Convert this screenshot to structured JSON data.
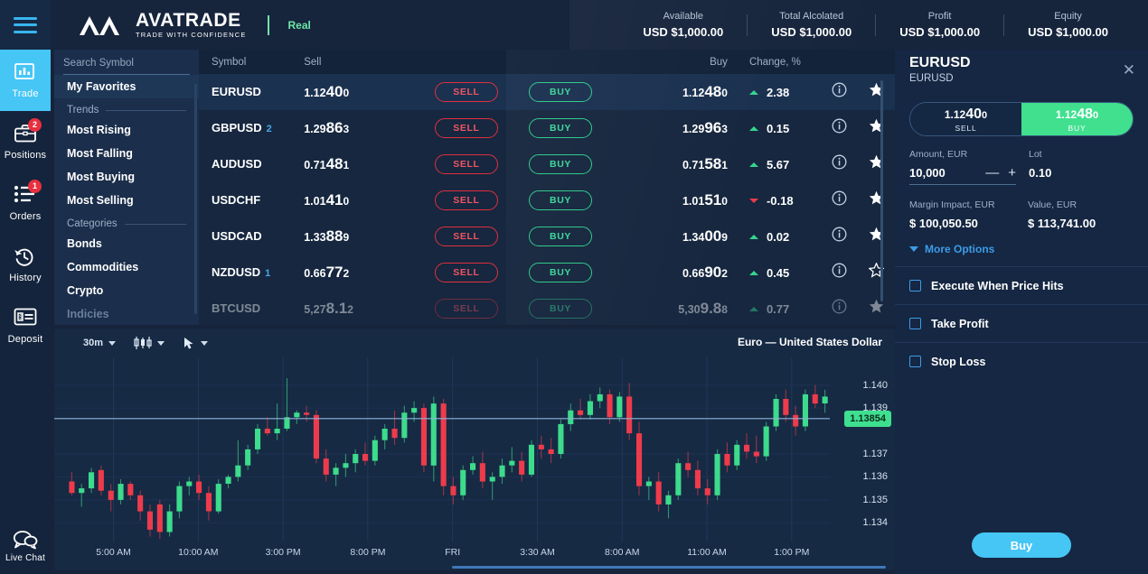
{
  "header": {
    "logo_main": "AVATRADE",
    "logo_sub": "TRADE WITH CONFIDENCE",
    "account_type": "Real",
    "accounts": [
      {
        "label": "Available",
        "value": "USD $1,000.00"
      },
      {
        "label": "Total Alcolated",
        "value": "USD $1,000.00"
      },
      {
        "label": "Profit",
        "value": "USD $1,000.00"
      },
      {
        "label": "Equity",
        "value": "USD $1,000.00"
      }
    ]
  },
  "rail": {
    "items": [
      {
        "label": "Trade",
        "icon": "bar-chart-icon",
        "badge": "",
        "active": true
      },
      {
        "label": "Positions",
        "icon": "briefcase-icon",
        "badge": "2",
        "active": false
      },
      {
        "label": "Orders",
        "icon": "list-icon",
        "badge": "1",
        "active": false
      },
      {
        "label": "History",
        "icon": "clock-history-icon",
        "badge": "",
        "active": false
      },
      {
        "label": "Deposit",
        "icon": "card-icon",
        "badge": "",
        "active": false
      }
    ],
    "live_chat": "Live Chat"
  },
  "symbol_nav": {
    "search_placeholder": "Search Symbol",
    "search_value": "",
    "favorites": "My Favorites",
    "trends_label": "Trends",
    "trends": [
      "Most Rising",
      "Most Falling",
      "Most Buying",
      "Most Selling"
    ],
    "categories_label": "Categories",
    "categories": [
      "Bonds",
      "Commodities",
      "Crypto",
      "Indicies"
    ]
  },
  "quotes": {
    "columns": {
      "symbol": "Symbol",
      "sell": "Sell",
      "buy": "Buy",
      "change": "Change, %"
    },
    "sell_button": "SELL",
    "buy_button": "BUY",
    "rows": [
      {
        "symbol": "EURUSD",
        "count": "",
        "sell": [
          "1.12",
          "40",
          "0"
        ],
        "buy": [
          "1.12",
          "48",
          "0"
        ],
        "change": "2.38",
        "dir": "up",
        "star": "filled",
        "selected": true,
        "faded": false
      },
      {
        "symbol": "GBPUSD",
        "count": "2",
        "sell": [
          "1.29",
          "86",
          "3"
        ],
        "buy": [
          "1.29",
          "96",
          "3"
        ],
        "change": "0.15",
        "dir": "up",
        "star": "filled",
        "selected": false,
        "faded": false
      },
      {
        "symbol": "AUDUSD",
        "count": "",
        "sell": [
          "0.71",
          "48",
          "1"
        ],
        "buy": [
          "0.71",
          "58",
          "1"
        ],
        "change": "5.67",
        "dir": "up",
        "star": "filled",
        "selected": false,
        "faded": false
      },
      {
        "symbol": "USDCHF",
        "count": "",
        "sell": [
          "1.01",
          "41",
          "0"
        ],
        "buy": [
          "1.01",
          "51",
          "0"
        ],
        "change": "-0.18",
        "dir": "down",
        "star": "filled",
        "selected": false,
        "faded": false
      },
      {
        "symbol": "USDCAD",
        "count": "",
        "sell": [
          "1.33",
          "88",
          "9"
        ],
        "buy": [
          "1.34",
          "00",
          "9"
        ],
        "change": "0.02",
        "dir": "up",
        "star": "filled",
        "selected": false,
        "faded": false
      },
      {
        "symbol": "NZDUSD",
        "count": "1",
        "sell": [
          "0.66",
          "77",
          "2"
        ],
        "buy": [
          "0.66",
          "90",
          "2"
        ],
        "change": "0.45",
        "dir": "up",
        "star": "empty",
        "selected": false,
        "faded": false
      },
      {
        "symbol": "BTCUSD",
        "count": "",
        "sell": [
          "5,27",
          "8.1",
          "2"
        ],
        "buy": [
          "5,30",
          "9.8",
          "8"
        ],
        "change": "0.77",
        "dir": "up",
        "star": "filled",
        "selected": false,
        "faded": true
      }
    ]
  },
  "chart": {
    "timeframe": "30m",
    "chart_type_icon": "candlestick-icon",
    "cursor_icon": "cursor-icon",
    "title": "Euro — United States Dollar",
    "current_price": "1.13854"
  },
  "chart_data": {
    "type": "candlestick",
    "title": "Euro — United States Dollar",
    "timeframe": "30m",
    "ylabel": "",
    "xlabel": "",
    "grid": true,
    "ylim": [
      1.1335,
      1.1405
    ],
    "y_ticks": [
      "1.140",
      "1.139",
      "1.137",
      "1.136",
      "1.135",
      "1.134"
    ],
    "x_ticks": [
      "5:00 AM",
      "10:00 AM",
      "3:00 PM",
      "8:00 PM",
      "FRI",
      "3:30 AM",
      "8:00 AM",
      "11:00 AM",
      "1:00 PM"
    ],
    "current_price": 1.13854,
    "price_line": 1.13854,
    "up_color": "#3ddb8c",
    "down_color": "#ee3b4b",
    "candles": [
      {
        "o": 1.1358,
        "h": 1.1362,
        "l": 1.1352,
        "c": 1.1353
      },
      {
        "o": 1.1353,
        "h": 1.1357,
        "l": 1.1347,
        "c": 1.1355
      },
      {
        "o": 1.1355,
        "h": 1.1364,
        "l": 1.1353,
        "c": 1.1362
      },
      {
        "o": 1.1363,
        "h": 1.1365,
        "l": 1.1352,
        "c": 1.1354
      },
      {
        "o": 1.1354,
        "h": 1.1357,
        "l": 1.1345,
        "c": 1.135
      },
      {
        "o": 1.135,
        "h": 1.1359,
        "l": 1.1348,
        "c": 1.1357
      },
      {
        "o": 1.1357,
        "h": 1.1358,
        "l": 1.135,
        "c": 1.1352
      },
      {
        "o": 1.1352,
        "h": 1.1354,
        "l": 1.1341,
        "c": 1.1345
      },
      {
        "o": 1.1345,
        "h": 1.1348,
        "l": 1.1334,
        "c": 1.1337
      },
      {
        "o": 1.1348,
        "h": 1.135,
        "l": 1.1333,
        "c": 1.1336
      },
      {
        "o": 1.1336,
        "h": 1.1348,
        "l": 1.1334,
        "c": 1.1345
      },
      {
        "o": 1.1345,
        "h": 1.1358,
        "l": 1.1342,
        "c": 1.1356
      },
      {
        "o": 1.1356,
        "h": 1.136,
        "l": 1.1352,
        "c": 1.1358
      },
      {
        "o": 1.1358,
        "h": 1.1361,
        "l": 1.135,
        "c": 1.1353
      },
      {
        "o": 1.1353,
        "h": 1.1356,
        "l": 1.1341,
        "c": 1.1345
      },
      {
        "o": 1.1345,
        "h": 1.1359,
        "l": 1.1344,
        "c": 1.1357
      },
      {
        "o": 1.1357,
        "h": 1.1361,
        "l": 1.1355,
        "c": 1.136
      },
      {
        "o": 1.136,
        "h": 1.1376,
        "l": 1.1358,
        "c": 1.1365
      },
      {
        "o": 1.1365,
        "h": 1.1374,
        "l": 1.1363,
        "c": 1.1372
      },
      {
        "o": 1.1372,
        "h": 1.1383,
        "l": 1.137,
        "c": 1.1381
      },
      {
        "o": 1.1381,
        "h": 1.1386,
        "l": 1.1378,
        "c": 1.1379
      },
      {
        "o": 1.1379,
        "h": 1.1392,
        "l": 1.1376,
        "c": 1.1381
      },
      {
        "o": 1.1381,
        "h": 1.1403,
        "l": 1.138,
        "c": 1.1386
      },
      {
        "o": 1.1386,
        "h": 1.1389,
        "l": 1.1383,
        "c": 1.1388
      },
      {
        "o": 1.1388,
        "h": 1.1391,
        "l": 1.1384,
        "c": 1.1387
      },
      {
        "o": 1.1387,
        "h": 1.1389,
        "l": 1.1366,
        "c": 1.1368
      },
      {
        "o": 1.1368,
        "h": 1.1372,
        "l": 1.1358,
        "c": 1.1361
      },
      {
        "o": 1.1361,
        "h": 1.1366,
        "l": 1.1356,
        "c": 1.1364
      },
      {
        "o": 1.1364,
        "h": 1.137,
        "l": 1.136,
        "c": 1.1366
      },
      {
        "o": 1.1366,
        "h": 1.1372,
        "l": 1.1362,
        "c": 1.137
      },
      {
        "o": 1.137,
        "h": 1.1375,
        "l": 1.1365,
        "c": 1.1367
      },
      {
        "o": 1.1367,
        "h": 1.1378,
        "l": 1.1365,
        "c": 1.1376
      },
      {
        "o": 1.1376,
        "h": 1.1383,
        "l": 1.1372,
        "c": 1.1381
      },
      {
        "o": 1.1381,
        "h": 1.1389,
        "l": 1.1374,
        "c": 1.1377
      },
      {
        "o": 1.1377,
        "h": 1.1391,
        "l": 1.1375,
        "c": 1.1388
      },
      {
        "o": 1.1388,
        "h": 1.1393,
        "l": 1.1384,
        "c": 1.139
      },
      {
        "o": 1.139,
        "h": 1.1392,
        "l": 1.1362,
        "c": 1.1365
      },
      {
        "o": 1.1365,
        "h": 1.1395,
        "l": 1.1358,
        "c": 1.1392
      },
      {
        "o": 1.1392,
        "h": 1.1394,
        "l": 1.1352,
        "c": 1.1356
      },
      {
        "o": 1.1356,
        "h": 1.136,
        "l": 1.1348,
        "c": 1.1352
      },
      {
        "o": 1.1352,
        "h": 1.1365,
        "l": 1.135,
        "c": 1.1363
      },
      {
        "o": 1.1363,
        "h": 1.1369,
        "l": 1.1361,
        "c": 1.1366
      },
      {
        "o": 1.1366,
        "h": 1.1371,
        "l": 1.1355,
        "c": 1.1358
      },
      {
        "o": 1.1358,
        "h": 1.1362,
        "l": 1.135,
        "c": 1.136
      },
      {
        "o": 1.136,
        "h": 1.1368,
        "l": 1.1357,
        "c": 1.1365
      },
      {
        "o": 1.1365,
        "h": 1.1373,
        "l": 1.1362,
        "c": 1.1367
      },
      {
        "o": 1.1367,
        "h": 1.1371,
        "l": 1.1358,
        "c": 1.1361
      },
      {
        "o": 1.1361,
        "h": 1.1376,
        "l": 1.136,
        "c": 1.1374
      },
      {
        "o": 1.1374,
        "h": 1.1378,
        "l": 1.1368,
        "c": 1.1372
      },
      {
        "o": 1.1372,
        "h": 1.1377,
        "l": 1.1366,
        "c": 1.137
      },
      {
        "o": 1.137,
        "h": 1.1385,
        "l": 1.1368,
        "c": 1.1383
      },
      {
        "o": 1.1383,
        "h": 1.1392,
        "l": 1.138,
        "c": 1.1389
      },
      {
        "o": 1.1389,
        "h": 1.1394,
        "l": 1.1385,
        "c": 1.1387
      },
      {
        "o": 1.1387,
        "h": 1.1396,
        "l": 1.1385,
        "c": 1.1393
      },
      {
        "o": 1.1393,
        "h": 1.1399,
        "l": 1.139,
        "c": 1.1396
      },
      {
        "o": 1.1396,
        "h": 1.1398,
        "l": 1.1383,
        "c": 1.1386
      },
      {
        "o": 1.1386,
        "h": 1.1397,
        "l": 1.1384,
        "c": 1.1395
      },
      {
        "o": 1.1395,
        "h": 1.1401,
        "l": 1.1376,
        "c": 1.1379
      },
      {
        "o": 1.1379,
        "h": 1.1384,
        "l": 1.1352,
        "c": 1.1356
      },
      {
        "o": 1.1356,
        "h": 1.136,
        "l": 1.135,
        "c": 1.1358
      },
      {
        "o": 1.1358,
        "h": 1.1362,
        "l": 1.1345,
        "c": 1.1348
      },
      {
        "o": 1.1348,
        "h": 1.1354,
        "l": 1.1342,
        "c": 1.1352
      },
      {
        "o": 1.1352,
        "h": 1.1368,
        "l": 1.135,
        "c": 1.1366
      },
      {
        "o": 1.1366,
        "h": 1.1371,
        "l": 1.136,
        "c": 1.1363
      },
      {
        "o": 1.1363,
        "h": 1.1367,
        "l": 1.1352,
        "c": 1.1355
      },
      {
        "o": 1.1355,
        "h": 1.1359,
        "l": 1.1348,
        "c": 1.1352
      },
      {
        "o": 1.1352,
        "h": 1.1372,
        "l": 1.135,
        "c": 1.137
      },
      {
        "o": 1.137,
        "h": 1.1375,
        "l": 1.1362,
        "c": 1.1365
      },
      {
        "o": 1.1365,
        "h": 1.1376,
        "l": 1.1363,
        "c": 1.1374
      },
      {
        "o": 1.1374,
        "h": 1.1379,
        "l": 1.1368,
        "c": 1.1371
      },
      {
        "o": 1.1371,
        "h": 1.1378,
        "l": 1.1366,
        "c": 1.1369
      },
      {
        "o": 1.1369,
        "h": 1.1384,
        "l": 1.1367,
        "c": 1.1382
      },
      {
        "o": 1.1382,
        "h": 1.1396,
        "l": 1.138,
        "c": 1.1394
      },
      {
        "o": 1.1394,
        "h": 1.1398,
        "l": 1.1384,
        "c": 1.1387
      },
      {
        "o": 1.1387,
        "h": 1.1391,
        "l": 1.1378,
        "c": 1.1382
      },
      {
        "o": 1.1382,
        "h": 1.1398,
        "l": 1.138,
        "c": 1.1396
      },
      {
        "o": 1.1396,
        "h": 1.14,
        "l": 1.139,
        "c": 1.1392
      },
      {
        "o": 1.1392,
        "h": 1.1398,
        "l": 1.1388,
        "c": 1.1395
      }
    ]
  },
  "panel": {
    "title": "EURUSD",
    "subtitle": "EURUSD",
    "close_icon": "close-icon",
    "sell_price": [
      "1.12",
      "40",
      "0"
    ],
    "buy_price": [
      "1.12",
      "48",
      "0"
    ],
    "sell_label": "SELL",
    "buy_label": "BUY",
    "amount_label": "Amount, EUR",
    "amount_value": "10,000",
    "minus": "—",
    "plus": "+",
    "lot_label": "Lot",
    "lot_value": "0.10",
    "margin_label": "Margin Impact, EUR",
    "margin_value": "$ 100,050.50",
    "value_label": "Value, EUR",
    "value_value": "$ 113,741.00",
    "more_options": "More Options",
    "options": [
      "Execute When Price Hits",
      "Take Profit",
      "Stop Loss"
    ],
    "submit": "Buy"
  },
  "colors": {
    "accent": "#46c6f5",
    "buy_green": "#40e08f",
    "sell_red": "#e0303f",
    "badge_red": "#e8303f"
  }
}
